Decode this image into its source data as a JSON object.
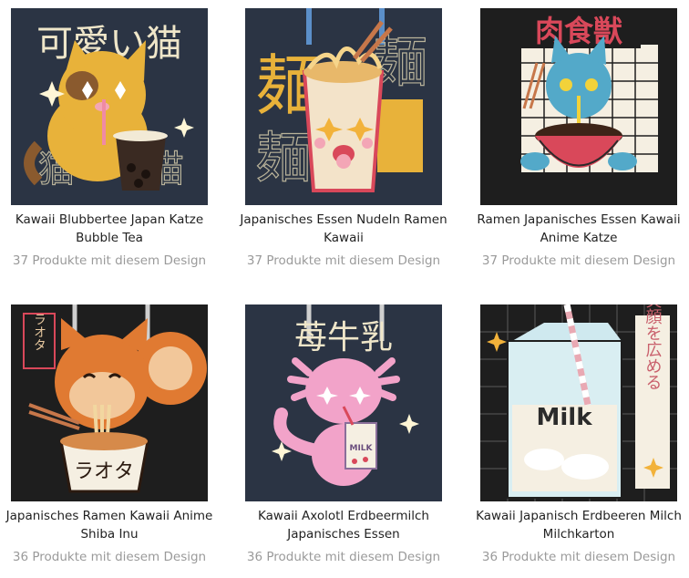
{
  "designs": [
    {
      "title": "Kawaii Blubbertee Japan Katze Bubble Tea",
      "count_text": "37 Produkte mit diesem Design",
      "art_text": "可愛い猫",
      "art_text_2": "猫",
      "art_text_3": "猫",
      "background": "#2b3444",
      "accent": "#e8b23a"
    },
    {
      "title": "Japanisches Essen Nudeln Ramen Kawaii",
      "count_text": "37 Produkte mit diesem Design",
      "art_text": "麺",
      "art_text_2": "麺",
      "art_text_3": "麺",
      "background": "#2b3444",
      "accent": "#e8b23a"
    },
    {
      "title": "Ramen Japanisches Essen Kawaii Anime Katze",
      "count_text": "37 Produkte mit diesem Design",
      "art_text": "肉食獣",
      "background": "#1e1e1e",
      "accent": "#d9485a"
    },
    {
      "title": "Japanisches Ramen Kawaii Anime Shiba Inu",
      "count_text": "36 Produkte mit diesem Design",
      "art_text": "ラオタ",
      "art_text_2": "ラオタ",
      "background": "#1e1e1e",
      "accent": "#e07a32"
    },
    {
      "title": "Kawaii Axolotl Erdbeermilch Japanisches Essen",
      "count_text": "36 Produkte mit diesem Design",
      "art_text": "苺牛乳",
      "art_text_2": "MILK",
      "background": "#2b3444",
      "accent": "#f2a3c9"
    },
    {
      "title": "Kawaii Japanisch Erdbeeren Milch Milchkarton",
      "count_text": "36 Produkte mit diesem Design",
      "art_text": "Milk",
      "art_text_2": "笑顔を広める",
      "background": "#1e1e1e",
      "accent": "#e9a9b3"
    }
  ]
}
